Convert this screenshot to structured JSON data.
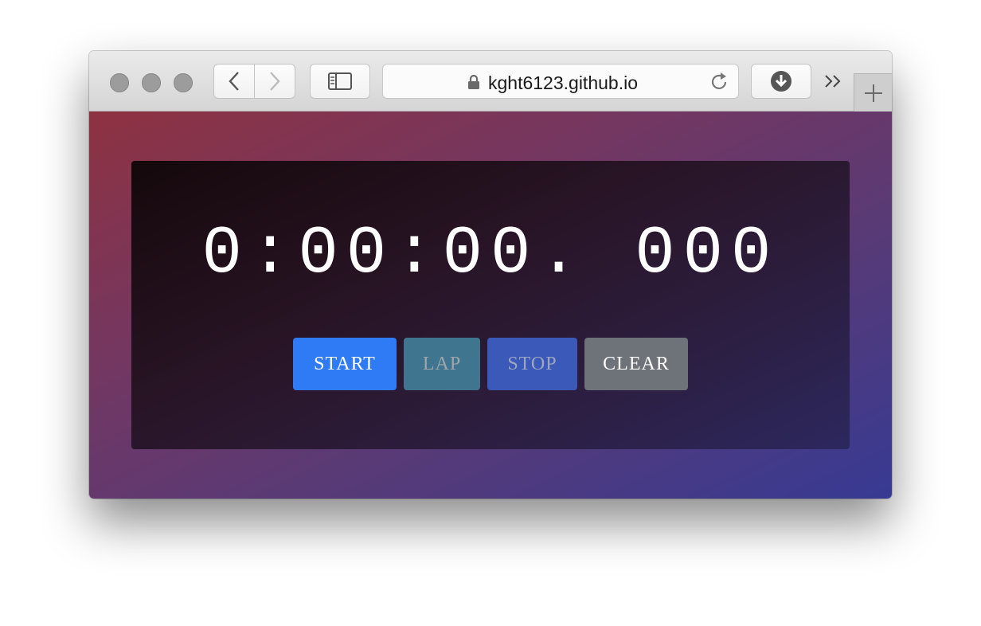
{
  "browser": {
    "url": "kght6123.github.io",
    "icons": [
      "close-light",
      "minimize-light",
      "zoom-light",
      "back-icon",
      "forward-icon",
      "sidebar-icon",
      "lock-icon",
      "reload-icon",
      "download-icon",
      "overflow-chevron-icon",
      "new-tab-plus-icon"
    ]
  },
  "stopwatch": {
    "time": "0:00:00. 000",
    "buttons": {
      "start": "START",
      "lap": "LAP",
      "stop": "STOP",
      "clear": "CLEAR"
    }
  },
  "colors": {
    "start_bg": "#2f7bf5",
    "lap_bg": "#407590",
    "stop_bg": "#3a59b8",
    "clear_bg": "#6e7279"
  }
}
